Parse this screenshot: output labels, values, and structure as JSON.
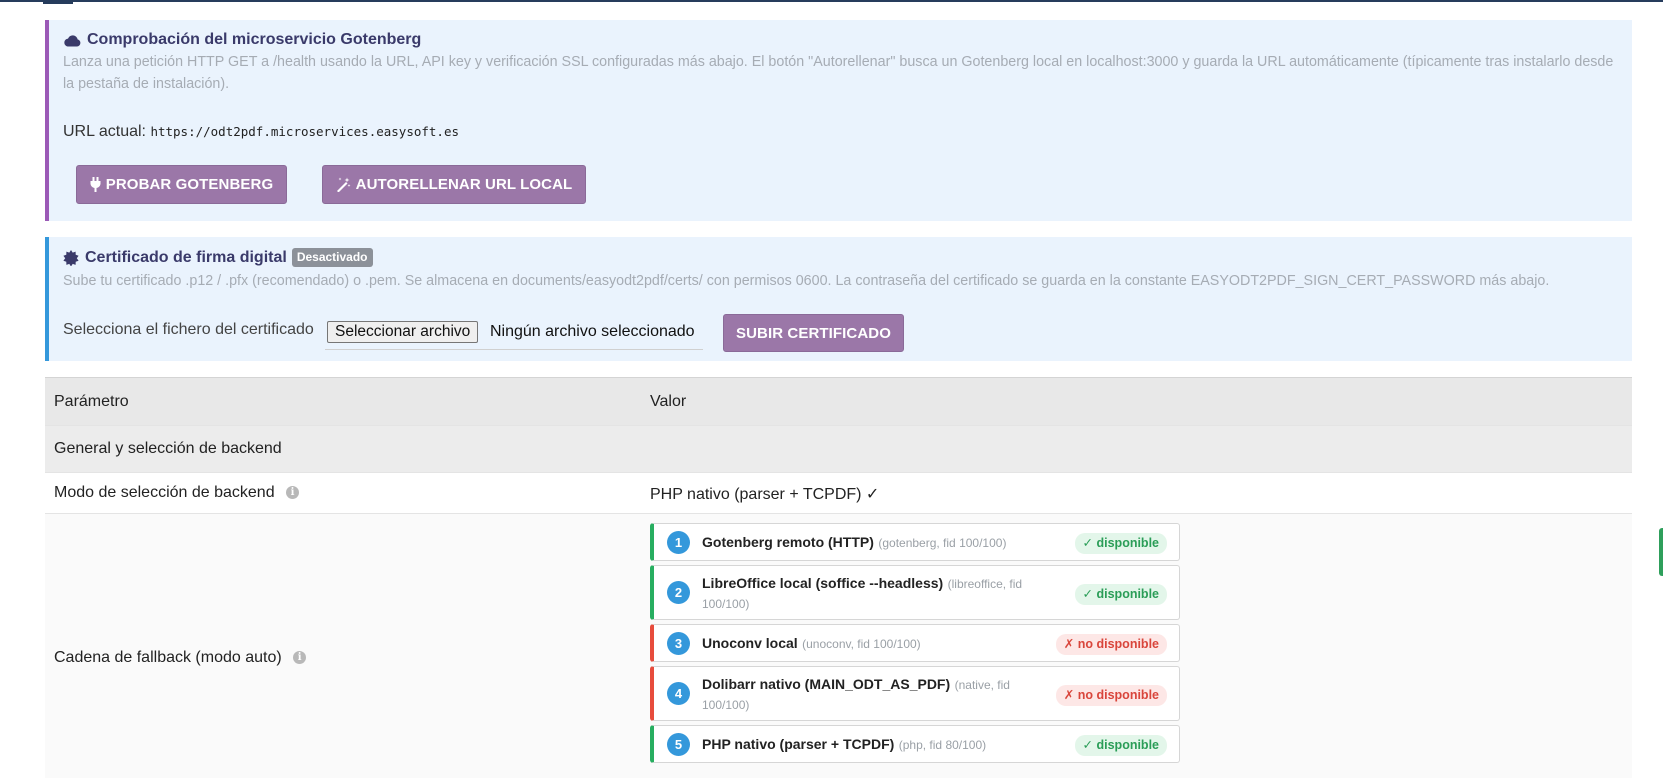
{
  "gotenberg": {
    "title": "Comprobación del microservicio Gotenberg",
    "title_icon": "cloud-icon",
    "description": "Lanza una petición HTTP GET a /health usando la URL, API key y verificación SSL configuradas más abajo. El botón \"Autorellenar\" busca un Gotenberg local en localhost:3000 y guarda la URL automáticamente (típicamente tras instalarlo desde la pestaña de instalación).",
    "url_label": "URL actual:",
    "url_value": "https://odt2pdf.microservices.easysoft.es",
    "test_button": "PROBAR GOTENBERG",
    "test_icon": "plug-icon",
    "autofill_button": "AUTORELLENAR URL LOCAL",
    "autofill_icon": "magic-wand-icon"
  },
  "certificate": {
    "title": "Certificado de firma digital",
    "title_icon": "seal-icon",
    "badge": "Desactivado",
    "description": "Sube tu certificado .p12 / .pfx (recomendado) o .pem. Se almacena en documents/easyodt2pdf/certs/ con permisos 0600. La contraseña del certificado se guarda en la constante EASYODT2PDF_SIGN_CERT_PASSWORD más abajo.",
    "file_label": "Selecciona el fichero del certificado",
    "file_button": "Seleccionar archivo",
    "file_status": "Ningún archivo seleccionado",
    "upload_button": "SUBIR CERTIFICADO"
  },
  "table": {
    "header_param": "Parámetro",
    "header_value": "Valor",
    "section_general": "General y selección de backend",
    "backend_mode_label": "Modo de selección de backend",
    "backend_mode_value": "PHP nativo (parser + TCPDF) ✓",
    "fallback_label": "Cadena de fallback (modo auto)",
    "info_icon": "info-icon",
    "fallback": [
      {
        "num": "1",
        "name": "Gotenberg remoto (HTTP)",
        "meta": "(gotenberg, fid 100/100)",
        "status": "✓ disponible",
        "available": true
      },
      {
        "num": "2",
        "name": "LibreOffice local (soffice --headless)",
        "meta": "(libreoffice, fid 100/100)",
        "status": "✓ disponible",
        "available": true
      },
      {
        "num": "3",
        "name": "Unoconv local",
        "meta": "(unoconv, fid 100/100)",
        "status": "✗ no disponible",
        "available": false
      },
      {
        "num": "4",
        "name": "Dolibarr nativo (MAIN_ODT_AS_PDF)",
        "meta": "(native, fid 100/100)",
        "status": "✗ no disponible",
        "available": false
      },
      {
        "num": "5",
        "name": "PHP nativo (parser + TCPDF)",
        "meta": "(php, fid 80/100)",
        "status": "✓ disponible",
        "available": true
      }
    ]
  }
}
